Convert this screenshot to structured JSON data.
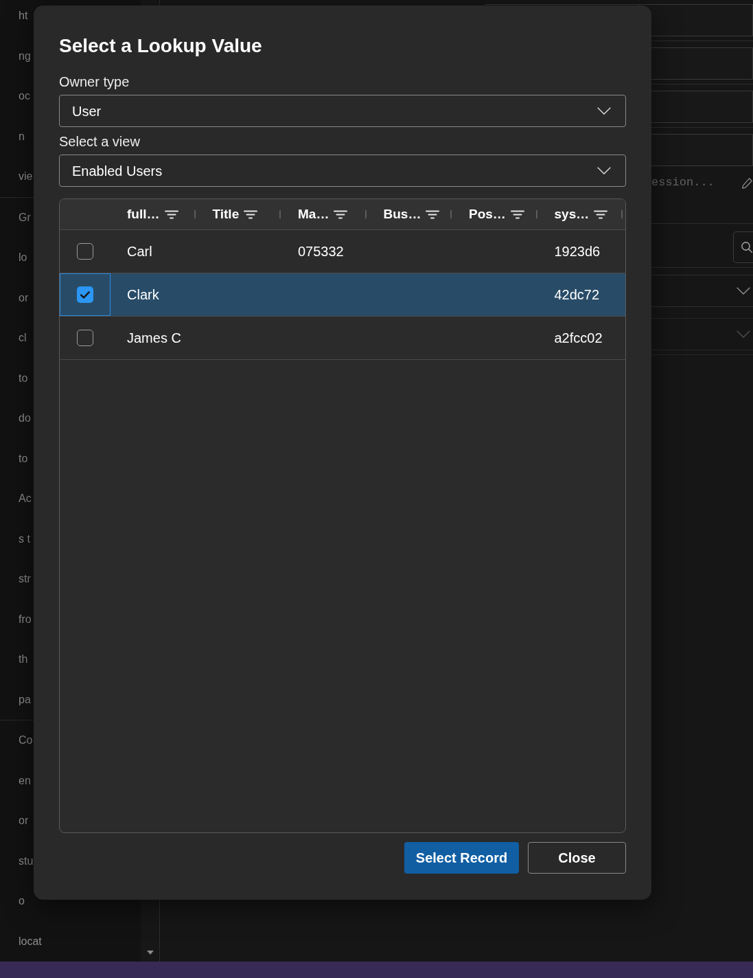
{
  "background": {
    "sidebar_groups": [
      {
        "items": [
          "ht",
          "ng",
          "oc",
          "n",
          "vie"
        ]
      },
      {
        "items": [
          "Gr",
          "lo",
          "or",
          "cl",
          "to",
          "do",
          "to",
          "Ac",
          "s t",
          "str",
          "fro",
          "th",
          "pa"
        ]
      },
      {
        "items": [
          "Co",
          "en",
          "or",
          "stu",
          "o",
          "locat"
        ]
      }
    ],
    "text_field": {
      "placeholder": "ession..."
    }
  },
  "dialog": {
    "title": "Select a Lookup Value",
    "fields": [
      {
        "label": "Owner type",
        "value": "User"
      },
      {
        "label": "Select a view",
        "value": "Enabled Users"
      }
    ],
    "table": {
      "columns": [
        "full…",
        "Title",
        "Ma…",
        "Bus…",
        "Pos…",
        "sys…"
      ],
      "rows": [
        {
          "selected": false,
          "checked": false,
          "cells": {
            "column_1": "Carl",
            "column_3": "075332",
            "column_6": "1923d6"
          }
        },
        {
          "selected": true,
          "checked": true,
          "cells": {
            "column_1": "Clark",
            "column_6": "42dc72"
          }
        },
        {
          "selected": false,
          "checked": false,
          "cells": {
            "column_1": "James C",
            "column_6": "a2fcc02"
          }
        }
      ]
    },
    "buttons": [
      {
        "label": "Select Record",
        "kind": "primary"
      },
      {
        "label": "Close",
        "kind": "secondary"
      }
    ]
  }
}
